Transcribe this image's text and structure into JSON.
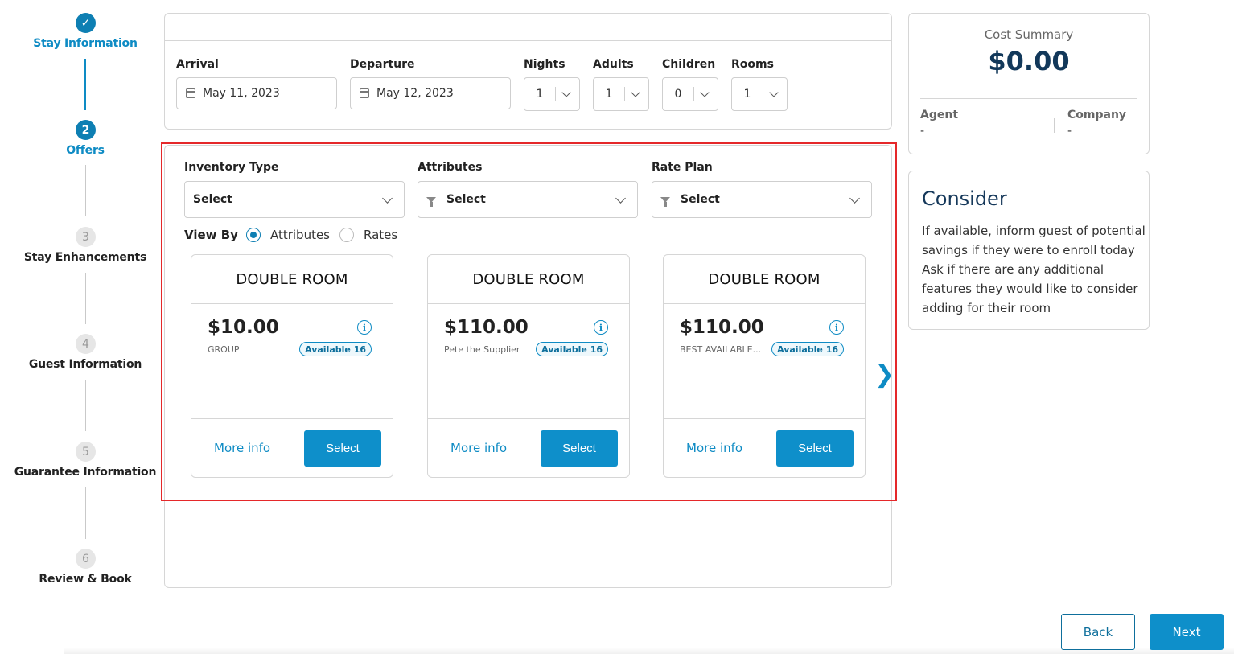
{
  "stepper": {
    "steps": [
      {
        "number": "✓",
        "label": "Stay Information",
        "state": "done"
      },
      {
        "number": "2",
        "label": "Offers",
        "state": "active"
      },
      {
        "number": "3",
        "label": "Stay Enhancements",
        "state": "pending"
      },
      {
        "number": "4",
        "label": "Guest Information",
        "state": "pending"
      },
      {
        "number": "5",
        "label": "Guarantee Information",
        "state": "pending"
      },
      {
        "number": "6",
        "label": "Review & Book",
        "state": "pending"
      }
    ]
  },
  "stay": {
    "arrival_label": "Arrival",
    "arrival_value": "May 11, 2023",
    "departure_label": "Departure",
    "departure_value": "May 12, 2023",
    "nights_label": "Nights",
    "nights_value": "1",
    "adults_label": "Adults",
    "adults_value": "1",
    "children_label": "Children",
    "children_value": "0",
    "rooms_label": "Rooms",
    "rooms_value": "1"
  },
  "filters": {
    "inventory_label": "Inventory Type",
    "inventory_value": "Select",
    "attributes_label": "Attributes",
    "attributes_value": "Select",
    "rateplan_label": "Rate Plan",
    "rateplan_value": "Select"
  },
  "view_by": {
    "label": "View By",
    "options": [
      "Attributes",
      "Rates"
    ],
    "selected": "Attributes"
  },
  "rooms": [
    {
      "title": "DOUBLE ROOM",
      "price": "$10.00",
      "plan": "GROUP",
      "available": "Available 16",
      "more": "More info",
      "select": "Select"
    },
    {
      "title": "DOUBLE ROOM",
      "price": "$110.00",
      "plan": "Pete the Supplier",
      "available": "Available 16",
      "more": "More info",
      "select": "Select"
    },
    {
      "title": "DOUBLE ROOM",
      "price": "$110.00",
      "plan": "BEST AVAILABLE...",
      "available": "Available 16",
      "more": "More info",
      "select": "Select"
    }
  ],
  "carousel": {
    "next_glyph": "❯"
  },
  "cost_summary": {
    "title": "Cost Summary",
    "total": "$0.00",
    "agent_label": "Agent",
    "agent_value": "-",
    "company_label": "Company",
    "company_value": "-"
  },
  "consider": {
    "title": "Consider",
    "text": "If available, inform guest of potential savings if they were to enroll today Ask if there are any additional features they would like to consider adding for their room"
  },
  "footer": {
    "back_label": "Back",
    "next_label": "Next"
  },
  "colors": {
    "accent": "#0e8fca",
    "highlight": "#e5282a",
    "heading": "#12385a"
  },
  "icons": {
    "calendar": "calendar-icon",
    "funnel": "filter-icon",
    "info": "info-icon",
    "chevron": "chevron-down-icon",
    "check": "check-icon"
  }
}
